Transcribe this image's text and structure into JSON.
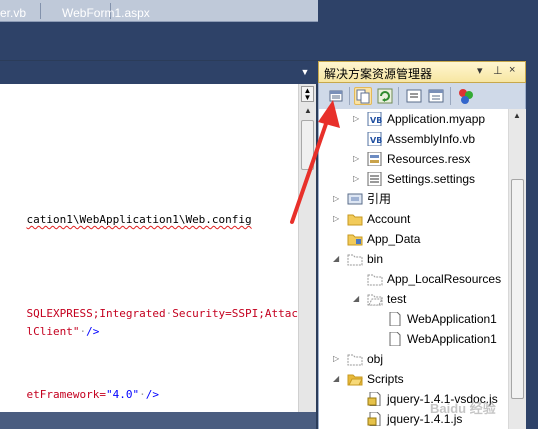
{
  "editor": {
    "tabs": [
      {
        "label": "er.vb"
      },
      {
        "label": "WebForm1.aspx"
      }
    ],
    "lines": [
      {
        "segments": [
          {
            "t": "cation1\\WebApplication1\\Web.config",
            "c": "blk squiggle"
          }
        ]
      },
      {
        "segments": [
          {
            "t": "SQLEXPRESS;Integrated",
            "c": "red"
          },
          {
            "t": "·",
            "c": "dot"
          },
          {
            "t": "Security=SSPI;AttachD",
            "c": "red"
          }
        ]
      },
      {
        "segments": [
          {
            "t": "lClient\"",
            "c": "red"
          },
          {
            "t": "·",
            "c": "dot"
          },
          {
            "t": "/>",
            "c": "blu"
          }
        ]
      },
      {
        "segments": [
          {
            "t": "etFramework=",
            "c": "red"
          },
          {
            "t": "\"4.0\"",
            "c": "blu"
          },
          {
            "t": "·",
            "c": "dot"
          },
          {
            "t": "/>",
            "c": "blu"
          }
        ]
      }
    ]
  },
  "solution_explorer": {
    "title": "解决方案资源管理器",
    "title_controls": [
      "▾",
      "⊥",
      "×"
    ],
    "toolbar_icons": [
      "properties-icon",
      "show-all-files-icon",
      "refresh-icon",
      "view-code-icon",
      "view-designer-icon",
      "class-diagram-icon"
    ],
    "nodes": [
      {
        "label": "Application.myapp",
        "icon": "vb-file-icon",
        "expander": "▷",
        "indent": 2
      },
      {
        "label": "AssemblyInfo.vb",
        "icon": "vb-file-icon",
        "expander": "",
        "indent": 2
      },
      {
        "label": "Resources.resx",
        "icon": "resx-file-icon",
        "expander": "▷",
        "indent": 2
      },
      {
        "label": "Settings.settings",
        "icon": "settings-file-icon",
        "expander": "▷",
        "indent": 2
      },
      {
        "label": "引用",
        "icon": "references-icon",
        "expander": "▷",
        "indent": 1
      },
      {
        "label": "Account",
        "icon": "folder-icon",
        "expander": "▷",
        "indent": 1
      },
      {
        "label": "App_Data",
        "icon": "special-folder-icon",
        "expander": "",
        "indent": 1
      },
      {
        "label": "bin",
        "icon": "hidden-folder-icon",
        "expander": "◢",
        "indent": 1
      },
      {
        "label": "App_LocalResources",
        "icon": "hidden-folder-icon",
        "expander": "",
        "indent": 2
      },
      {
        "label": "test",
        "icon": "hidden-folder-open-icon",
        "expander": "◢",
        "indent": 2
      },
      {
        "label": "WebApplication1",
        "icon": "file-icon",
        "expander": "",
        "indent": 3
      },
      {
        "label": "WebApplication1",
        "icon": "file-icon",
        "expander": "",
        "indent": 3
      },
      {
        "label": "obj",
        "icon": "hidden-folder-icon",
        "expander": "▷",
        "indent": 1
      },
      {
        "label": "Scripts",
        "icon": "folder-open-icon",
        "expander": "◢",
        "indent": 1
      },
      {
        "label": "jquery-1.4.1-vsdoc.js",
        "icon": "js-file-icon",
        "expander": "",
        "indent": 2
      },
      {
        "label": "jquery-1.4.1.js",
        "icon": "js-file-icon",
        "expander": "",
        "indent": 2
      }
    ]
  },
  "annotation": {
    "color": "#e8302a",
    "icon": "red-arrow-pointer"
  },
  "watermark": "Baidu 经验",
  "colors": {
    "background": "#2e4268",
    "title_active": "#f7e6a2",
    "toolbar": "#cfd9e8"
  }
}
